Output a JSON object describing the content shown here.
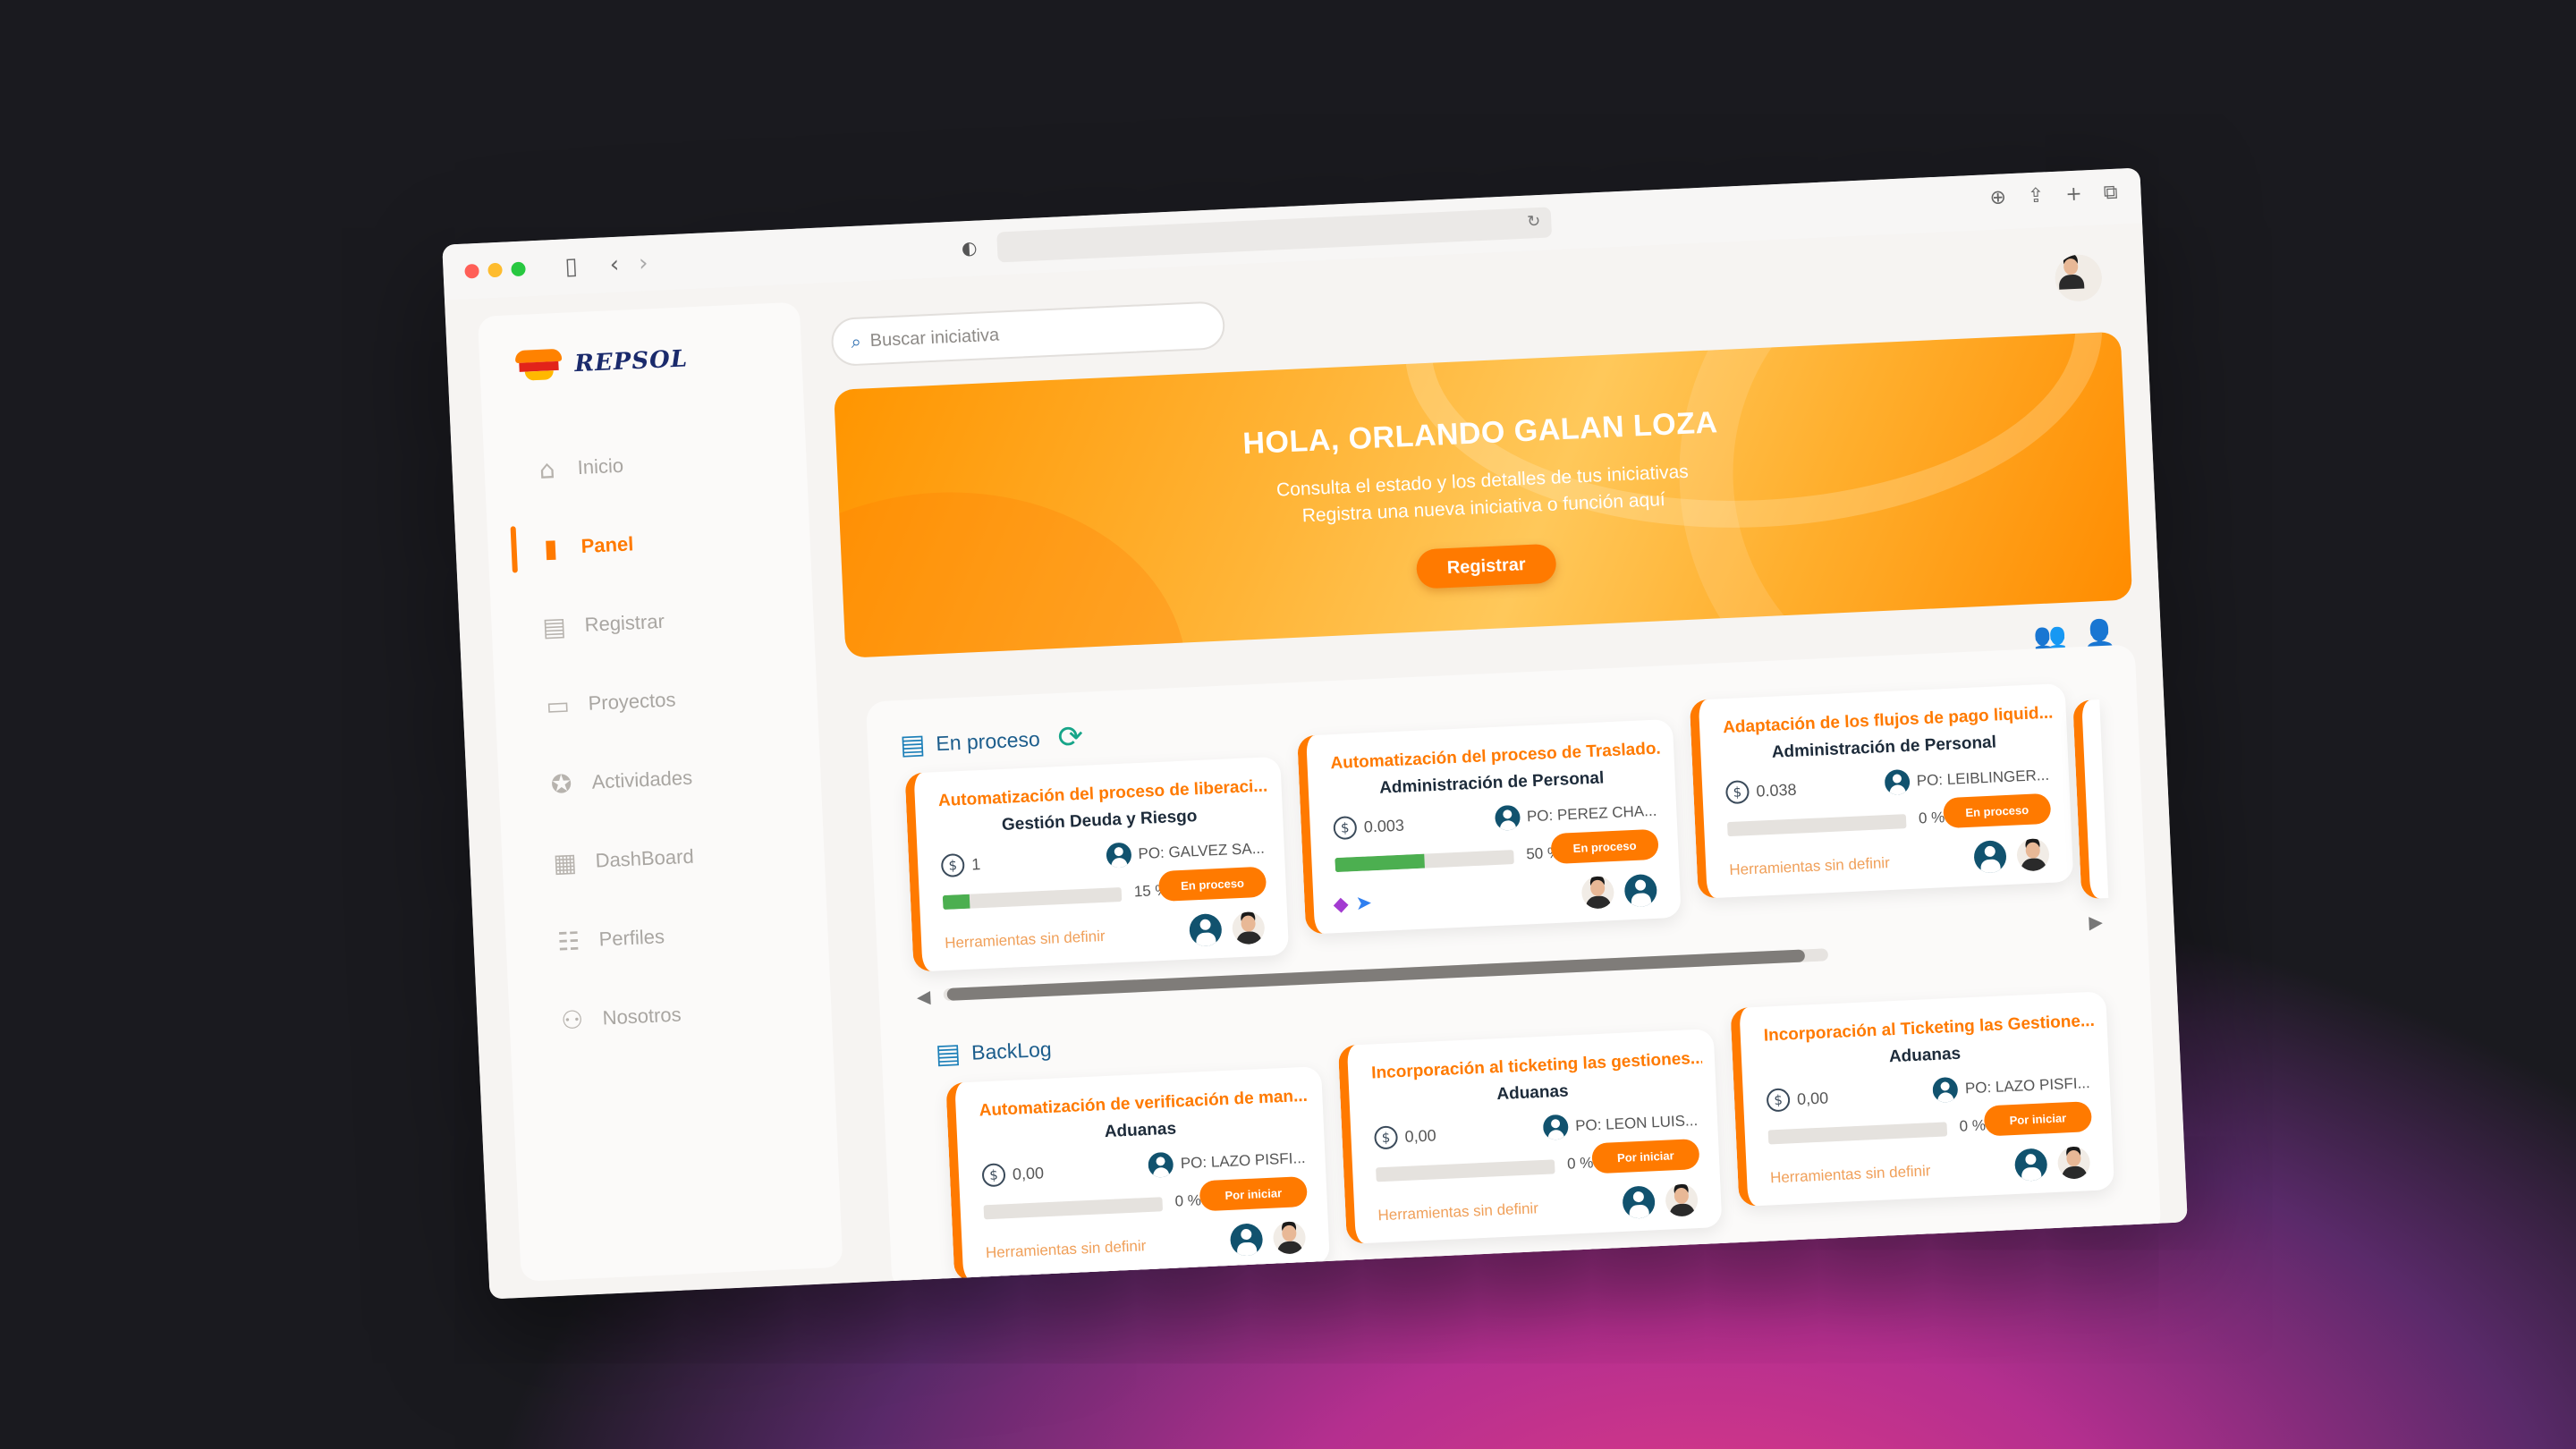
{
  "browser": {
    "traffic_lights": [
      "#ff5f57",
      "#febc2e",
      "#28c840"
    ],
    "icons": [
      "sidebar-toggle-icon",
      "back-icon",
      "forward-icon",
      "shield-icon",
      "reload-icon",
      "download-icon",
      "share-icon",
      "new-tab-icon",
      "tabs-overview-icon"
    ]
  },
  "brand": {
    "name": "REPSOL",
    "accent": "#ff7a00"
  },
  "sidebar": {
    "items": [
      {
        "label": "Inicio",
        "icon": "home-icon",
        "active": false
      },
      {
        "label": "Panel",
        "icon": "bar-chart-icon",
        "active": true
      },
      {
        "label": "Registrar",
        "icon": "document-icon",
        "active": false
      },
      {
        "label": "Proyectos",
        "icon": "folder-icon",
        "active": false
      },
      {
        "label": "Actividades",
        "icon": "badge-check-icon",
        "active": false
      },
      {
        "label": "DashBoard",
        "icon": "dashboard-icon",
        "active": false
      },
      {
        "label": "Perfiles",
        "icon": "users-icon",
        "active": false
      },
      {
        "label": "Nosotros",
        "icon": "team-icon",
        "active": false
      }
    ]
  },
  "search": {
    "placeholder": "Buscar iniciativa"
  },
  "hero": {
    "title": "HOLA, ORLANDO GALAN LOZA",
    "line1": "Consulta el estado y los detalles de tus iniciativas",
    "line2": "Registra una nueva iniciativa o función aquí",
    "button": "Registrar"
  },
  "sections": {
    "in_process": {
      "title": "En proceso",
      "cards": [
        {
          "title": "Automatización del proceso de liberaci...",
          "area": "Gestión Deuda y Riesgo",
          "amount": "1",
          "po": "PO: GALVEZ SA...",
          "progress": 15,
          "pct": "15 %",
          "status": "En proceso",
          "tools": "Herramientas sin definir"
        },
        {
          "title": "Automatización del proceso de Traslado...",
          "area": "Administración de Personal",
          "amount": "0.003",
          "po": "PO: PEREZ CHA...",
          "progress": 50,
          "pct": "50 %",
          "status": "En proceso",
          "tools": "",
          "tool_icons": [
            "power-apps-icon",
            "power-automate-icon"
          ]
        },
        {
          "title": "Adaptación de los flujos de pago liquid...",
          "area": "Administración de Personal",
          "amount": "0.038",
          "po": "PO: LEIBLINGER...",
          "progress": 0,
          "pct": "0 %",
          "status": "En proceso",
          "tools": "Herramientas sin definir"
        }
      ]
    },
    "backlog": {
      "title": "BackLog",
      "cards": [
        {
          "title": "Automatización de verificación de man...",
          "area": "Aduanas",
          "amount": "0,00",
          "po": "PO: LAZO PISFI...",
          "progress": 0,
          "pct": "0 %",
          "status": "Por iniciar",
          "tools": "Herramientas sin definir"
        },
        {
          "title": "Incorporación al ticketing las gestiones...",
          "area": "Aduanas",
          "amount": "0,00",
          "po": "PO: LEON LUIS...",
          "progress": 0,
          "pct": "0 %",
          "status": "Por iniciar",
          "tools": "Herramientas sin definir"
        },
        {
          "title": "Incorporación al Ticketing las Gestione...",
          "area": "Aduanas",
          "amount": "0,00",
          "po": "PO: LAZO PISFI...",
          "progress": 0,
          "pct": "0 %",
          "status": "Por iniciar",
          "tools": "Herramientas sin definir"
        }
      ]
    }
  }
}
